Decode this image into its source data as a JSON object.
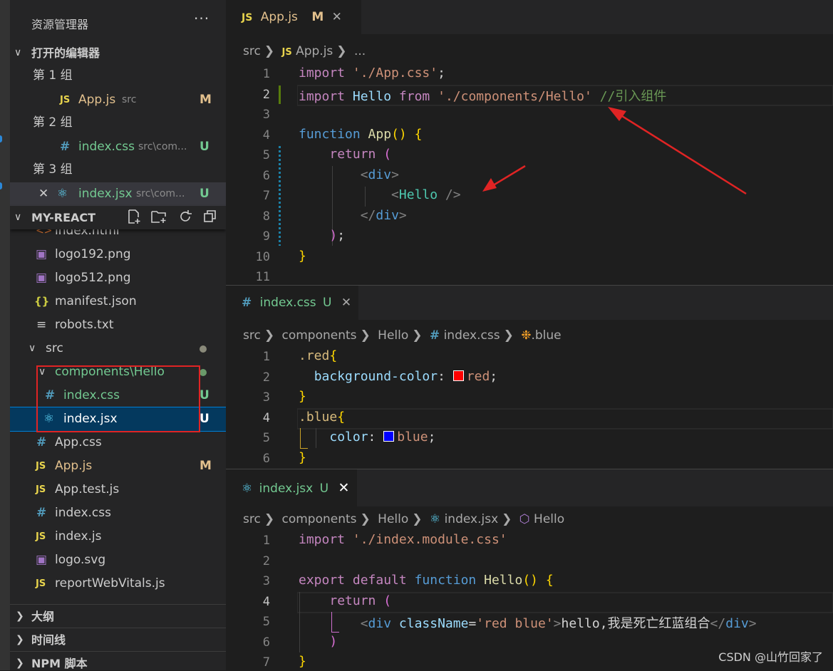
{
  "sidebar": {
    "title": "资源管理器",
    "more": "···",
    "open_editors": {
      "label": "打开的编辑器",
      "groups": [
        {
          "label": "第 1 组",
          "file": "App.js",
          "dir": "src",
          "status": "M"
        },
        {
          "label": "第 2 组",
          "file": "index.css",
          "dir": "src\\com...",
          "status": "U"
        },
        {
          "label": "第 3 组",
          "file": "index.jsx",
          "dir": "src\\com...",
          "status": "U"
        }
      ]
    },
    "project": {
      "label": "MY-REACT",
      "files": [
        {
          "name": "index.html",
          "icon": "html-icon"
        },
        {
          "name": "logo192.png",
          "icon": "image-icon"
        },
        {
          "name": "logo512.png",
          "icon": "image-icon"
        },
        {
          "name": "manifest.json",
          "icon": "json-icon"
        },
        {
          "name": "robots.txt",
          "icon": "text-icon"
        },
        {
          "name": "src",
          "icon": "folder-icon"
        },
        {
          "name": "components\\Hello",
          "icon": "folder-icon"
        },
        {
          "name": "index.css",
          "icon": "css-icon",
          "status": "U"
        },
        {
          "name": "index.jsx",
          "icon": "react-icon",
          "status": "U"
        },
        {
          "name": "App.css",
          "icon": "css-icon"
        },
        {
          "name": "App.js",
          "icon": "js-icon",
          "status": "M"
        },
        {
          "name": "App.test.js",
          "icon": "js-icon"
        },
        {
          "name": "index.css",
          "icon": "css-icon"
        },
        {
          "name": "index.js",
          "icon": "js-icon"
        },
        {
          "name": "logo.svg",
          "icon": "svg-icon"
        },
        {
          "name": "reportWebVitals.js",
          "icon": "js-icon"
        }
      ]
    },
    "outline": "大纲",
    "timeline": "时间线",
    "npm": "NPM 脚本"
  },
  "editor1": {
    "tab": {
      "label": "App.js",
      "status": "M",
      "badge": "JS"
    },
    "breadcrumb": [
      "src",
      "App.js",
      "..."
    ],
    "line_numbers": [
      "1",
      "2",
      "3",
      "4",
      "5",
      "6",
      "7",
      "8",
      "9",
      "10",
      "11"
    ]
  },
  "editor2": {
    "tab": {
      "label": "index.css",
      "status": "U"
    },
    "breadcrumb": [
      "src",
      "components",
      "Hello",
      "index.css",
      ".blue"
    ],
    "line_numbers": [
      "1",
      "2",
      "3",
      "4",
      "5",
      "6"
    ]
  },
  "editor3": {
    "tab": {
      "label": "index.jsx",
      "status": "U"
    },
    "breadcrumb": [
      "src",
      "components",
      "Hello",
      "index.jsx",
      "Hello"
    ],
    "line_numbers": [
      "1",
      "2",
      "3",
      "4",
      "5",
      "6",
      "7"
    ]
  },
  "watermark": "CSDN @山竹回家了",
  "colors": {
    "annotation_red": "#e02424",
    "accent": "#007fd4"
  }
}
